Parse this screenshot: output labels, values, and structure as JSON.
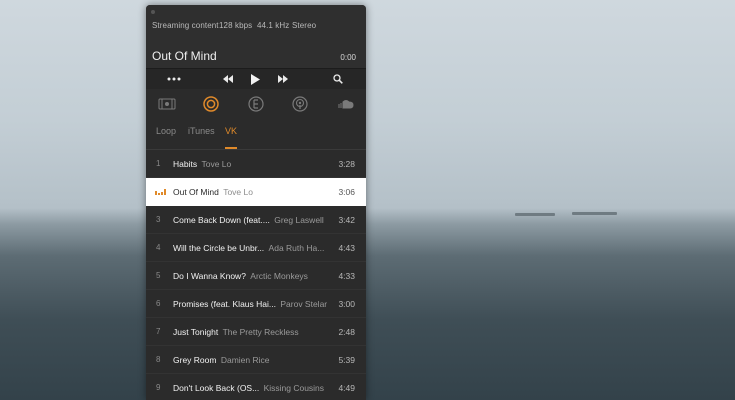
{
  "info": {
    "source": "Streaming content",
    "bitrate": "128 kbps",
    "samplerate": "44.1 kHz",
    "channels": "Stereo"
  },
  "now_playing": {
    "title": "Out Of Mind",
    "time": "0:00"
  },
  "controls": [
    "more-icon",
    "previous-icon",
    "play-icon",
    "next-icon",
    "search-icon"
  ],
  "sources": [
    "library-icon",
    "loop-icon",
    "itunes-icon",
    "podcast-icon",
    "soundcloud-icon"
  ],
  "tabs": [
    {
      "label": "Loop",
      "active": false
    },
    {
      "label": "iTunes",
      "active": false
    },
    {
      "label": "VK",
      "active": true
    }
  ],
  "accent_color": "#e08a2a",
  "tracks": [
    {
      "num": "1",
      "title": "Habits",
      "artist": "Tove Lo",
      "duration": "3:28",
      "current": false
    },
    {
      "num": "",
      "title": "Out Of Mind",
      "artist": "Tove Lo",
      "duration": "3:06",
      "current": true
    },
    {
      "num": "3",
      "title": "Come Back Down (feat....",
      "artist": "Greg Laswell",
      "duration": "3:42",
      "current": false
    },
    {
      "num": "4",
      "title": "Will the Circle be Unbr...",
      "artist": "Ada Ruth Ha...",
      "duration": "4:43",
      "current": false
    },
    {
      "num": "5",
      "title": "Do I Wanna Know?",
      "artist": "Arctic Monkeys",
      "duration": "4:33",
      "current": false
    },
    {
      "num": "6",
      "title": "Promises (feat. Klaus Hai...",
      "artist": "Parov Stelar",
      "duration": "3:00",
      "current": false
    },
    {
      "num": "7",
      "title": "Just Tonight",
      "artist": "The Pretty Reckless",
      "duration": "2:48",
      "current": false
    },
    {
      "num": "8",
      "title": "Grey Room",
      "artist": "Damien Rice",
      "duration": "5:39",
      "current": false
    },
    {
      "num": "9",
      "title": "Don't Look Back (OS...",
      "artist": "Kissing Cousins",
      "duration": "4:49",
      "current": false
    }
  ]
}
